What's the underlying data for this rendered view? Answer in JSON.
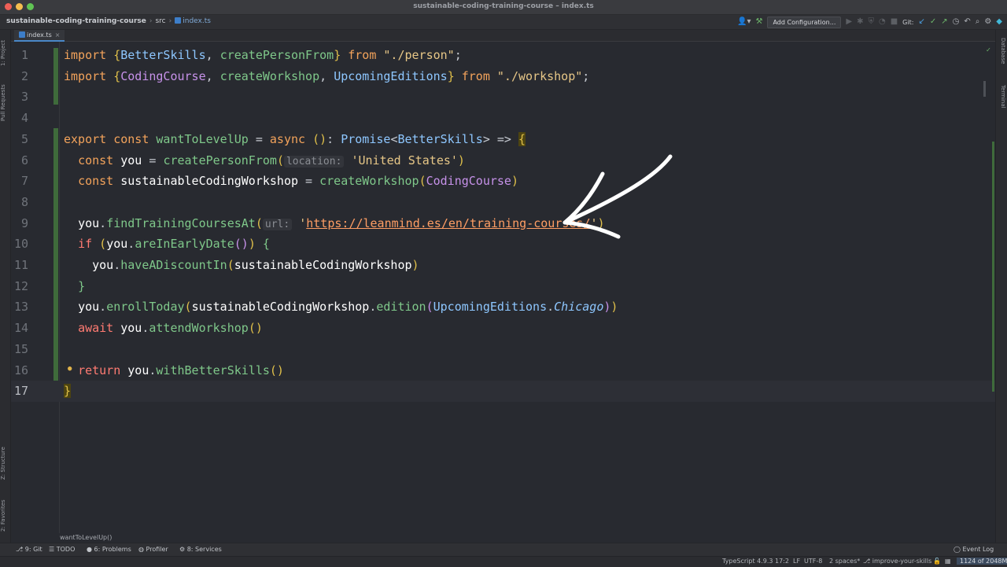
{
  "window": {
    "title": "sustainable-coding-training-course – index.ts"
  },
  "navbar": {
    "project": "sustainable-coding-training-course",
    "folder": "src",
    "file": "index.ts",
    "add_configuration": "Add Configuration...",
    "git_label": "Git:"
  },
  "left_stripe": {
    "project": "1: Project",
    "pull_requests": "Pull Requests",
    "structure": "Z: Structure",
    "favorites": "2: Favorites"
  },
  "right_stripe": {
    "database": "Database",
    "terminal": "Terminal"
  },
  "editor_tab": {
    "label": "index.ts"
  },
  "lines": [
    "1",
    "2",
    "3",
    "4",
    "5",
    "6",
    "7",
    "8",
    "9",
    "10",
    "11",
    "12",
    "13",
    "14",
    "15",
    "16",
    "17"
  ],
  "code": {
    "l1": {
      "import": "import",
      "open": "{",
      "a": "BetterSkills",
      "comma": ", ",
      "b": "createPersonFrom",
      "close": "}",
      "from": "from",
      "path": "\"./person\"",
      "semi": ";"
    },
    "l2": {
      "import": "import",
      "open": "{",
      "a": "CodingCourse",
      "c1": ", ",
      "b": "createWorkshop",
      "c2": ", ",
      "c": "UpcomingEditions",
      "close": "}",
      "from": "from",
      "path": "\"./workshop\"",
      "semi": ";"
    },
    "l5": {
      "export": "export",
      "const": "const",
      "name": "wantToLevelUp",
      "eq": " = ",
      "async": "async",
      "params": "()",
      "colon": ": ",
      "promise": "Promise",
      "lt": "<",
      "type": "BetterSkills",
      "gt": ">",
      "arrow": " => ",
      "brace": "{"
    },
    "l6": {
      "const": "const",
      "name": "you",
      "eq": " = ",
      "fn": "createPersonFrom",
      "open": "(",
      "hint": "location:",
      "arg": "'United States'",
      "close": ")"
    },
    "l7": {
      "const": "const",
      "name": "sustainableCodingWorkshop",
      "eq": " = ",
      "fn": "createWorkshop",
      "open": "(",
      "arg": "CodingCourse",
      "close": ")"
    },
    "l9": {
      "obj": "you",
      "dot": ".",
      "fn": "findTrainingCoursesAt",
      "open": "(",
      "hint": "url:",
      "q1": "'",
      "url": "https://leanmind.es/en/training-courses/",
      "q2": "'",
      "close": ")"
    },
    "l10": {
      "if": "if",
      "open": "(",
      "obj": "you",
      "dot": ".",
      "fn": "areInEarlyDate",
      "call": "()",
      "close": ")",
      "brace": "{"
    },
    "l11": {
      "obj": "you",
      "dot": ".",
      "fn": "haveADiscountIn",
      "open": "(",
      "arg": "sustainableCodingWorkshop",
      "close": ")"
    },
    "l12": {
      "brace": "}"
    },
    "l13": {
      "obj": "you",
      "dot": ".",
      "fn": "enrollToday",
      "open": "(",
      "arg": "sustainableCodingWorkshop",
      "dot2": ".",
      "fn2": "edition",
      "open2": "(",
      "enum": "UpcomingEditions",
      "dot3": ".",
      "member": "Chicago",
      "close2": ")",
      "close": ")"
    },
    "l14": {
      "await": "await",
      "obj": "you",
      "dot": ".",
      "fn": "attendWorkshop",
      "call": "()"
    },
    "l16": {
      "return": "return",
      "obj": "you",
      "dot": ".",
      "fn": "withBetterSkills",
      "call": "()"
    },
    "l17": {
      "brace": "}"
    }
  },
  "editor_breadcrumb": "wantToLevelUp()",
  "tool_windows": {
    "git": "9: Git",
    "todo": "TODO",
    "problems": "6: Problems",
    "profiler": "Profiler",
    "services": "8: Services",
    "event_log": "Event Log"
  },
  "status": {
    "language": "TypeScript 4.9.3",
    "position": "17:2",
    "line_sep": "LF",
    "encoding": "UTF-8",
    "indent": "2 spaces*",
    "branch": "improve-your-skills",
    "memory": "1124 of 2048M"
  },
  "colors": {
    "background": "#282a30",
    "keyword": "#ff7b72",
    "string": "#e7c787",
    "function": "#7fc88a",
    "type": "#c792ea"
  }
}
